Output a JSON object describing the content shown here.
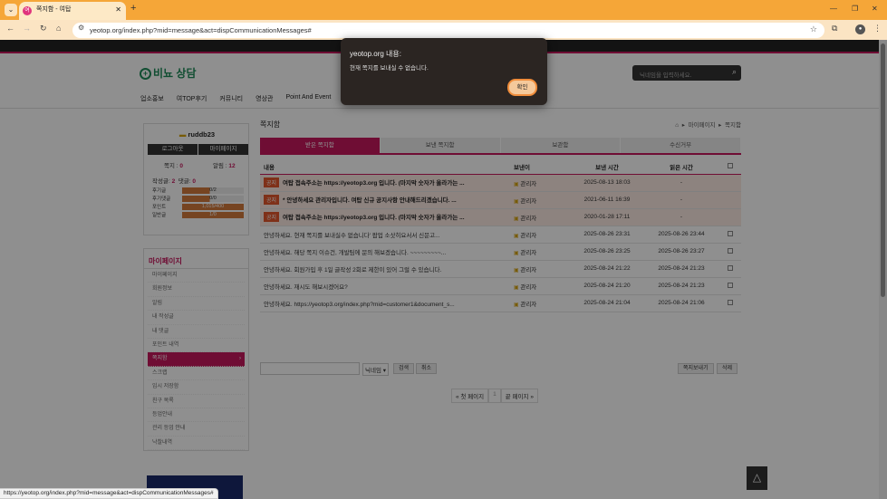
{
  "browser": {
    "tab_title": "쪽지함 - 여탑",
    "tab_favicon": "여",
    "url": "yeotop.org/index.php?mid=message&act=dispCommunicationMessages#",
    "status_url": "https://yeotop.org/index.php?mid=message&act=dispCommunicationMessages#",
    "profile_initial": "●"
  },
  "dialog": {
    "title": "yeotop.org 내용:",
    "message": "현재 쪽지를 보내실 수 없습니다.",
    "ok": "확인"
  },
  "site": {
    "logo": "비뇨 상담",
    "search_placeholder": "닉네임을 입력하세요.",
    "nav": [
      "업소홍보",
      "여TOP후기",
      "커뮤니티",
      "영상관",
      "Point And Event"
    ]
  },
  "user": {
    "name": "ruddb23",
    "logout": "로그아웃",
    "mypage": "마이페이지",
    "stats": [
      {
        "label": "쪽지",
        "value": "0"
      },
      {
        "label": "알림",
        "value": "12"
      }
    ],
    "counts": {
      "posts_label": "작성글",
      "posts": "2",
      "comments_label": "댓글",
      "comments": "0"
    },
    "bars": [
      {
        "label": "후기글",
        "value": "0/2",
        "fill": 0
      },
      {
        "label": "후기댓글",
        "value": "0/0",
        "fill": 0
      },
      {
        "label": "포인트",
        "value": "1,015/400",
        "fill": 1
      },
      {
        "label": "일반글",
        "value": "1/0",
        "fill": 1
      }
    ]
  },
  "mypage": {
    "title": "마이페이지",
    "items": [
      "마이페이지",
      "회원정보",
      "알림",
      "내 작성글",
      "내 댓글",
      "포인트 내역",
      "쪽지함",
      "스크랩",
      "임시 저장함",
      "친구 목록",
      "등업안내",
      "관리 등업 안내",
      "낙찰내역"
    ],
    "active_index": 6
  },
  "content": {
    "title": "쪽지함",
    "breadcrumb": [
      "마이페이지",
      "쪽지함"
    ],
    "tabs": [
      "받은 쪽지함",
      "보낸 쪽지함",
      "보관함",
      "수신거부"
    ],
    "active_tab": 0,
    "headers": {
      "content": "내용",
      "sender": "보낸이",
      "sent": "보낸 시간",
      "read": "읽은 시간"
    },
    "notice_tag": "공지",
    "notices": [
      {
        "subject": "여탑 접속주소는 https://yeotop3.org 입니다. (마지막 숫자가 올라가는 ...",
        "sender": "관리자",
        "sent": "2025-08-13 18:03",
        "read": "-"
      },
      {
        "subject": "* 안녕하세요 관리자입니다. 여탑 신규 공지사항 안내해드리겠습니다. ...",
        "sender": "관리자",
        "sent": "2021-06-11 16:39",
        "read": "-"
      },
      {
        "subject": "여탑 접속주소는 https://yeotop3.org 입니다. (마지막 숫자가 올라가는 ...",
        "sender": "관리자",
        "sent": "2020-01-28 17:11",
        "read": "-"
      }
    ],
    "messages": [
      {
        "subject": "안녕하세요. 현재 쪽지를 보내실수 없습니다' 팝업 소삿히요서서 신문고...",
        "sender": "관리자",
        "sent": "2025-08-26 23:31",
        "read": "2025-08-26 23:44"
      },
      {
        "subject": "안녕하세요. 해당 쪽지 이슈건, 개발팀에 문의 해보겠습니다. ~~~~~~~~~...",
        "sender": "관리자",
        "sent": "2025-08-26 23:25",
        "read": "2025-08-26 23:27"
      },
      {
        "subject": "안녕하세요. 회원가입 후 1일 글작성 2회로 제한이 있어 그럴 수 있습니다.",
        "sender": "관리자",
        "sent": "2025-08-24 21:22",
        "read": "2025-08-24 21:23"
      },
      {
        "subject": "안녕하세요. 재시도 해보시겠어요?",
        "sender": "관리자",
        "sent": "2025-08-24 21:20",
        "read": "2025-08-24 21:23"
      },
      {
        "subject": "안녕하세요. https://yeotop3.org/index.php?mid=customer1&document_s...",
        "sender": "관리자",
        "sent": "2025-08-24 21:04",
        "read": "2025-08-24 21:06"
      }
    ],
    "search_select": "닉네임",
    "search_btn": "검색",
    "cancel_btn": "취소",
    "send_btn": "쪽지보내기",
    "delete_btn": "삭제",
    "pager": {
      "first": "« 첫 페이지",
      "current": "1",
      "last": "끝 페이지 »"
    }
  }
}
